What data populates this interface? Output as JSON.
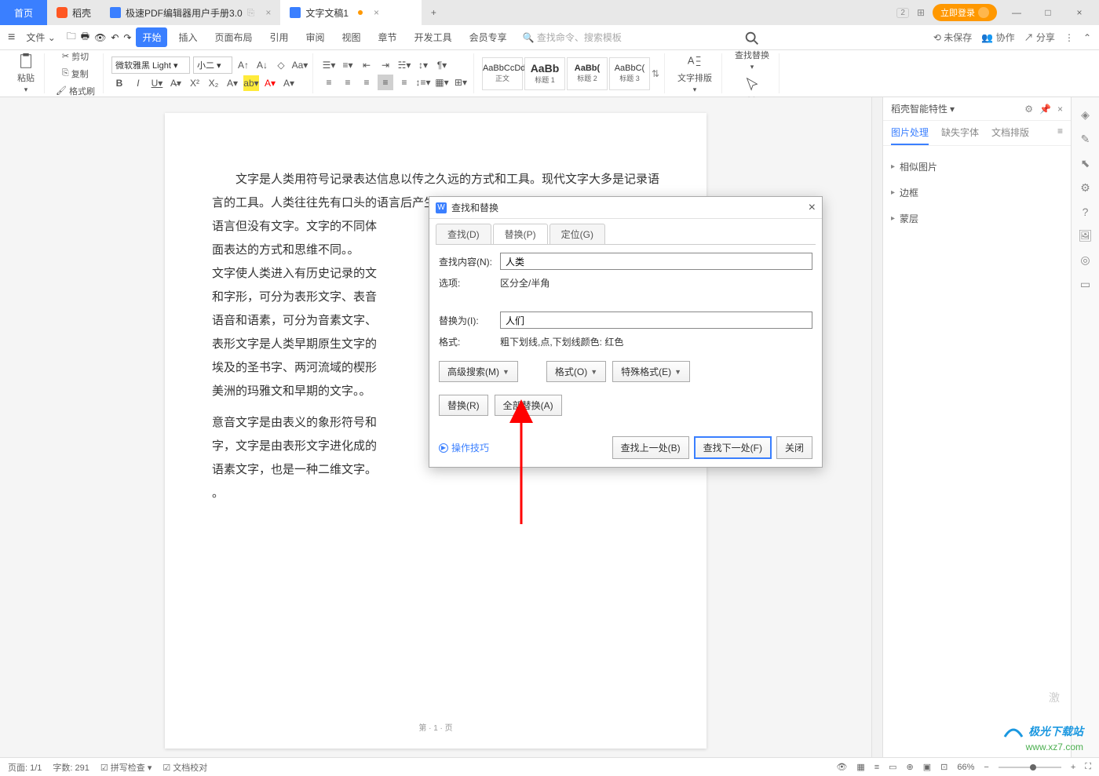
{
  "titlebar": {
    "home": "首页",
    "app_tab": "稻壳",
    "doc1": "极速PDF编辑器用户手册3.0",
    "doc2": "文字文稿1",
    "login": "立即登录",
    "grid_icon": "⊞"
  },
  "menu": {
    "file": "文件",
    "items": [
      "开始",
      "插入",
      "页面布局",
      "引用",
      "审阅",
      "视图",
      "章节",
      "开发工具",
      "会员专享"
    ],
    "search_placeholder": "查找命令、搜索模板",
    "unsaved": "未保存",
    "coop": "协作",
    "share": "分享"
  },
  "ribbon": {
    "paste": "粘贴",
    "cut": "剪切",
    "copy": "复制",
    "format_painter": "格式刷",
    "font_name": "微软雅黑 Light",
    "font_size": "小二",
    "styles": [
      {
        "preview": "AaBbCcDd",
        "name": "正文"
      },
      {
        "preview": "AaBb",
        "name": "标题 1"
      },
      {
        "preview": "AaBb(",
        "name": "标题 2"
      },
      {
        "preview": "AaBbC(",
        "name": "标题 3"
      }
    ],
    "text_layout": "文字排版",
    "find_replace": "查找替换",
    "select": "选择"
  },
  "document": {
    "paragraphs": [
      "　　文字是人类用符号记录表达信息以传之久远的方式和工具。现代文字大多是记录语言的工具。人类往往先有口头的语言后产生书面文",
      "语言但没有文字。文字的不同体",
      "面表达的方式和思维不同。。",
      "文字使人类进入有历史记录的文",
      "和字形，可分为表形文字、表音",
      "语音和语素，可分为音素文字、",
      "表形文字是人类早期原生文字的",
      "埃及的圣书字、两河流域的楔形",
      "美洲的玛雅文和早期的文字。。",
      "意音文字是由表义的象形符号和",
      "字，文字是由表形文字进化成的",
      "语素文字，也是一种二维文字。"
    ],
    "page_number": "第 · 1 · 页"
  },
  "right_panel": {
    "title": "稻壳智能特性",
    "tabs": [
      "图片处理",
      "缺失字体",
      "文档排版"
    ],
    "items": [
      "相似图片",
      "边框",
      "蒙层"
    ]
  },
  "dialog": {
    "title": "查找和替换",
    "tabs": {
      "find": "查找(D)",
      "replace": "替换(P)",
      "goto": "定位(G)"
    },
    "find_label": "查找内容(N):",
    "find_value": "人类",
    "options_label": "选项:",
    "options_value": "区分全/半角",
    "replace_label": "替换为(I):",
    "replace_value": "人们",
    "format_label": "格式:",
    "format_value": "粗下划线,点,下划线颜色: 红色",
    "adv_search": "高级搜索(M)",
    "format_btn": "格式(O)",
    "special_btn": "特殊格式(E)",
    "replace_btn": "替换(R)",
    "replace_all_btn": "全部替换(A)",
    "ops_tip": "操作技巧",
    "find_prev": "查找上一处(B)",
    "find_next": "查找下一处(F)",
    "close": "关闭"
  },
  "statusbar": {
    "page": "页面: 1/1",
    "words": "字数: 291",
    "spellcheck": "拼写检查",
    "proofing": "文档校对",
    "zoom": "66%",
    "activate": "激"
  },
  "watermark": {
    "name": "极光下载站",
    "url": "www.xz7.com"
  }
}
